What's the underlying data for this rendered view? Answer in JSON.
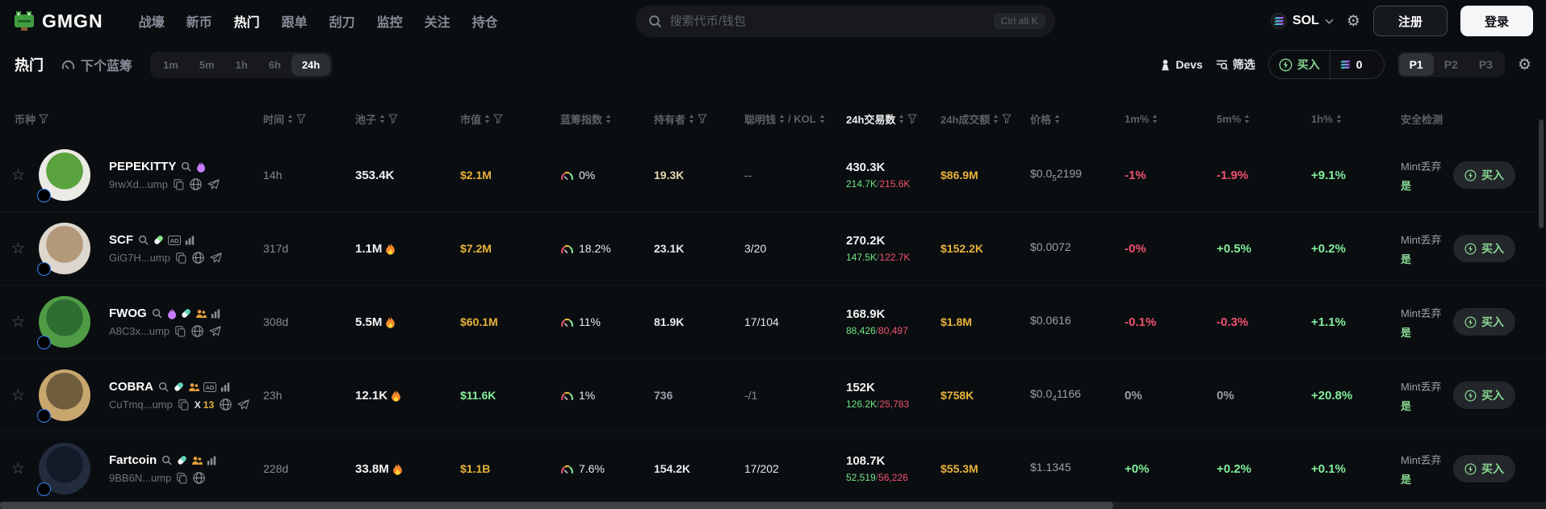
{
  "header": {
    "logo": "GMGN",
    "nav": [
      "战壕",
      "新币",
      "热门",
      "跟单",
      "刮刀",
      "监控",
      "关注",
      "持仓"
    ],
    "nav_active": "热门",
    "search_placeholder": "搜索代币/钱包",
    "search_shortcut": "Ctrl alt K",
    "chain": "SOL",
    "register": "注册",
    "login": "登录"
  },
  "toolbar": {
    "hot": "热门",
    "next_bluechip": "下个蓝筹",
    "timeframes": [
      "1m",
      "5m",
      "1h",
      "6h",
      "24h"
    ],
    "timeframe_active": "24h",
    "devs": "Devs",
    "filter": "筛选",
    "buy": "买入",
    "buy_amount": "0",
    "presets": [
      "P1",
      "P2",
      "P3"
    ],
    "preset_active": "P1"
  },
  "table": {
    "buy_label": "买入",
    "columns": [
      {
        "label": "币种",
        "filter": true
      },
      {
        "label": "时间",
        "sort": true,
        "filter": true
      },
      {
        "label": "池子",
        "sort": true,
        "filter": true
      },
      {
        "label": "市值",
        "sort": true,
        "filter": true
      },
      {
        "label": "蓝筹指数",
        "sort": true
      },
      {
        "label": "持有者",
        "sort": true,
        "filter": true
      },
      {
        "label": "聪明钱",
        "sort": true,
        "label2": "/ KOL",
        "sort2": true
      },
      {
        "label": "24h交易数",
        "sort": true,
        "filter": true,
        "active": true
      },
      {
        "label": "24h成交额",
        "sort": true,
        "filter": true
      },
      {
        "label": "价格",
        "sort": true
      },
      {
        "label": "1m%",
        "sort": true
      },
      {
        "label": "5m%",
        "sort": true
      },
      {
        "label": "1h%",
        "sort": true
      },
      {
        "label": "安全检测"
      }
    ],
    "rows": [
      {
        "name": "PEPEKITTY",
        "badges": [
          "flame-purple"
        ],
        "address": "9rwXd...ump",
        "links": [
          {
            "icon": "copy"
          },
          {
            "icon": "globe"
          },
          {
            "icon": "telegram"
          }
        ],
        "age": "14h",
        "pool": "353.4K",
        "pool_fire": false,
        "mcap": "$2.1M",
        "mcap_color": "#e8b33a",
        "bluechip": "0%",
        "holders": "19.3K",
        "holders_color": "#e5d8ae",
        "smart_kol": "--",
        "smart_color": "#858b96",
        "txs": "430.3K",
        "txs_buy": "214.7K",
        "txs_sell": "215.6K",
        "volume": "$86.9M",
        "price_a": "$0.0",
        "price_sub": "5",
        "price_b": "2199",
        "chg_1m": "-1%",
        "chg_5m": "-1.9%",
        "chg_1h": "+9.1%",
        "security_label": "Mint丢弃",
        "security_value": "是",
        "avatar_c1": "#eceae4",
        "avatar_c2": "#5aa33f"
      },
      {
        "name": "SCF",
        "badges": [
          "pill-green",
          "ad",
          "chart"
        ],
        "address": "GiG7H...ump",
        "links": [
          {
            "icon": "copy"
          },
          {
            "icon": "globe"
          },
          {
            "icon": "telegram"
          }
        ],
        "age": "317d",
        "pool": "1.1M",
        "pool_fire": true,
        "mcap": "$7.2M",
        "mcap_color": "#e8b33a",
        "bluechip": "18.2%",
        "holders": "23.1K",
        "holders_color": "#e6e9ee",
        "smart_kol": "3/20",
        "smart_color": "#e6e9ee",
        "txs": "270.2K",
        "txs_buy": "147.5K",
        "txs_sell": "122.7K",
        "volume": "$152.2K",
        "price_a": "$0.0072",
        "price_sub": "",
        "price_b": "",
        "chg_1m": "-0%",
        "chg_5m": "+0.5%",
        "chg_1h": "+0.2%",
        "security_label": "Mint丢弃",
        "security_value": "是",
        "avatar_c1": "#dcd6cc",
        "avatar_c2": "#b3987a"
      },
      {
        "name": "FWOG",
        "badges": [
          "flame-purple",
          "pill-teal",
          "people",
          "chart"
        ],
        "address": "A8C3x...ump",
        "links": [
          {
            "icon": "copy"
          },
          {
            "icon": "globe"
          },
          {
            "icon": "telegram"
          }
        ],
        "age": "308d",
        "pool": "5.5M",
        "pool_fire": true,
        "mcap": "$60.1M",
        "mcap_color": "#e8b33a",
        "bluechip": "11%",
        "holders": "81.9K",
        "holders_color": "#e6e9ee",
        "smart_kol": "17/104",
        "smart_color": "#e6e9ee",
        "txs": "168.9K",
        "txs_buy": "88,426",
        "txs_sell": "80,497",
        "volume": "$1.8M",
        "price_a": "$0.0616",
        "price_sub": "",
        "price_b": "",
        "chg_1m": "-0.1%",
        "chg_5m": "-0.3%",
        "chg_1h": "+1.1%",
        "security_label": "Mint丢弃",
        "security_value": "是",
        "avatar_c1": "#4f9c44",
        "avatar_c2": "#2e6e31"
      },
      {
        "name": "COBRA",
        "badges": [
          "pill-teal",
          "people",
          "ad",
          "chart"
        ],
        "address": "CuTmq...ump",
        "links": [
          {
            "icon": "copy"
          },
          {
            "icon": "x",
            "count": "13"
          },
          {
            "icon": "globe"
          },
          {
            "icon": "telegram"
          }
        ],
        "age": "23h",
        "pool": "12.1K",
        "pool_fire": true,
        "mcap": "$11.6K",
        "mcap_color": "#82ee9b",
        "bluechip": "1%",
        "holders": "736",
        "holders_color": "#9ba1ab",
        "smart_kol": "-/1",
        "smart_color": "#858b96",
        "txs": "152K",
        "txs_buy": "126.2K",
        "txs_sell": "25,783",
        "volume": "$758K",
        "price_a": "$0.0",
        "price_sub": "4",
        "price_b": "1166",
        "chg_1m": "0%",
        "chg_5m": "0%",
        "chg_1h": "+20.8%",
        "security_label": "Mint丢弃",
        "security_value": "是",
        "avatar_c1": "#c8a76e",
        "avatar_c2": "#6f5d3e"
      },
      {
        "name": "Fartcoin",
        "badges": [
          "pill-teal",
          "people",
          "chart"
        ],
        "address": "9BB6N...ump",
        "links": [
          {
            "icon": "copy"
          },
          {
            "icon": "globe"
          }
        ],
        "age": "228d",
        "pool": "33.8M",
        "pool_fire": true,
        "mcap": "$1.1B",
        "mcap_color": "#e8b33a",
        "bluechip": "7.6%",
        "holders": "154.2K",
        "holders_color": "#e6e9ee",
        "smart_kol": "17/202",
        "smart_color": "#e6e9ee",
        "txs": "108.7K",
        "txs_buy": "52,519",
        "txs_sell": "56,226",
        "volume": "$55.3M",
        "price_a": "$1.1345",
        "price_sub": "",
        "price_b": "",
        "chg_1m": "+0%",
        "chg_5m": "+0.2%",
        "chg_1h": "+0.1%",
        "security_label": "Mint丢弃",
        "security_value": "是",
        "avatar_c1": "#232c3e",
        "avatar_c2": "#141a28"
      }
    ]
  },
  "colors": {
    "accent_green": "#88d693",
    "up_green": "#82ee9b",
    "down_red": "#f0516e",
    "value_yellow": "#e8b33a",
    "muted_gray": "#5c6168"
  }
}
